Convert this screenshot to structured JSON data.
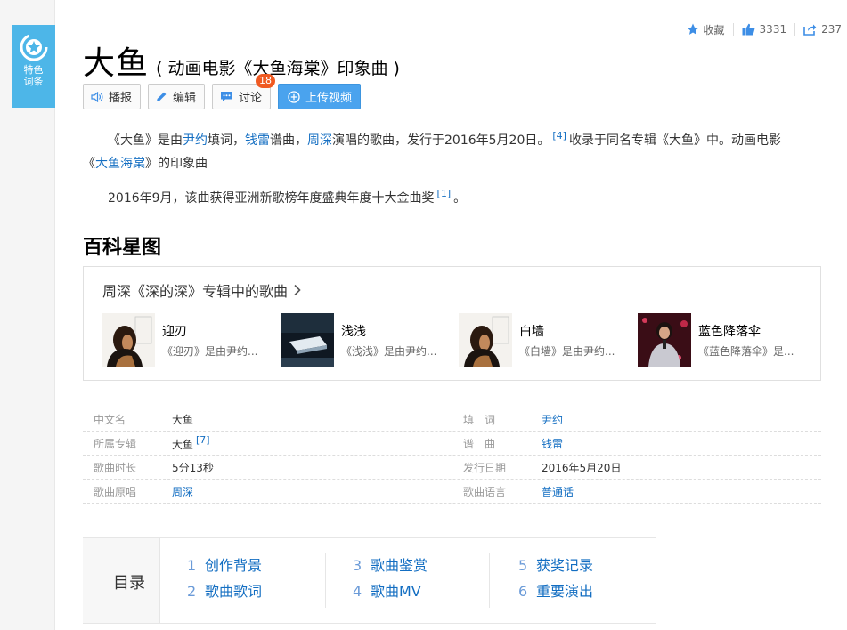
{
  "sidebar": {
    "badge_line1": "特色",
    "badge_line2": "词条"
  },
  "top_actions": {
    "favorite_label": "收藏",
    "like_count": "3331",
    "share_count": "237"
  },
  "title": {
    "main": "大鱼",
    "sub": "( 动画电影《大鱼海棠》印象曲 )"
  },
  "toolbar": {
    "play": "播报",
    "edit": "编辑",
    "discuss": "讨论",
    "discuss_count": "18",
    "upload": "上传视频"
  },
  "intro": {
    "p1_a": "《大鱼》是由",
    "p1_link1": "尹约",
    "p1_b": "填词，",
    "p1_link2": "钱雷",
    "p1_c": "谱曲，",
    "p1_link3": "周深",
    "p1_d": "演唱的歌曲，发行于2016年5月20日。",
    "p1_ref": "[4]",
    "p1_e": "收录于同名专辑《大鱼》中。动画电影",
    "p1_f": "《",
    "p1_link4": "大鱼海棠",
    "p1_g": "》的印象曲",
    "p2_a": "2016年9月，该曲获得亚洲新歌榜年度盛典年度十大金曲奖",
    "p2_ref": "[1]",
    "p2_b": "。"
  },
  "star_map": {
    "section_title": "百科星图",
    "box_title": "周深《深的深》专辑中的歌曲",
    "songs": [
      {
        "name": "迎刃",
        "desc": "《迎刃》是由尹约..."
      },
      {
        "name": "浅浅",
        "desc": "《浅浅》是由尹约..."
      },
      {
        "name": "白墙",
        "desc": "《白墙》是由尹约..."
      },
      {
        "name": "蓝色降落伞",
        "desc": "《蓝色降落伞》是..."
      }
    ]
  },
  "info": {
    "rows": [
      {
        "k1": "中文名",
        "v1": "大鱼",
        "k2": "填　词",
        "v2": "尹约"
      },
      {
        "k1": "所属专辑",
        "v1": "大鱼",
        "ref": "[7]",
        "k2": "谱　曲",
        "v2": "钱雷"
      },
      {
        "k1": "歌曲时长",
        "v1": "5分13秒",
        "k2": "发行日期",
        "v2": "2016年5月20日"
      },
      {
        "k1": "歌曲原唱",
        "v1": "周深",
        "k2": "歌曲语言",
        "v2": "普通话"
      }
    ]
  },
  "toc": {
    "label": "目录",
    "items": [
      {
        "num": "1",
        "text": "创作背景"
      },
      {
        "num": "2",
        "text": "歌曲歌词"
      },
      {
        "num": "3",
        "text": "歌曲鉴赏"
      },
      {
        "num": "4",
        "text": "歌曲MV"
      },
      {
        "num": "5",
        "text": "获奖记录"
      },
      {
        "num": "6",
        "text": "重要演出"
      }
    ]
  },
  "colors": {
    "link": "#136ec2",
    "badge": "#4db6e8",
    "upload": "#4aa3ee",
    "count_badge": "#f05a22"
  }
}
